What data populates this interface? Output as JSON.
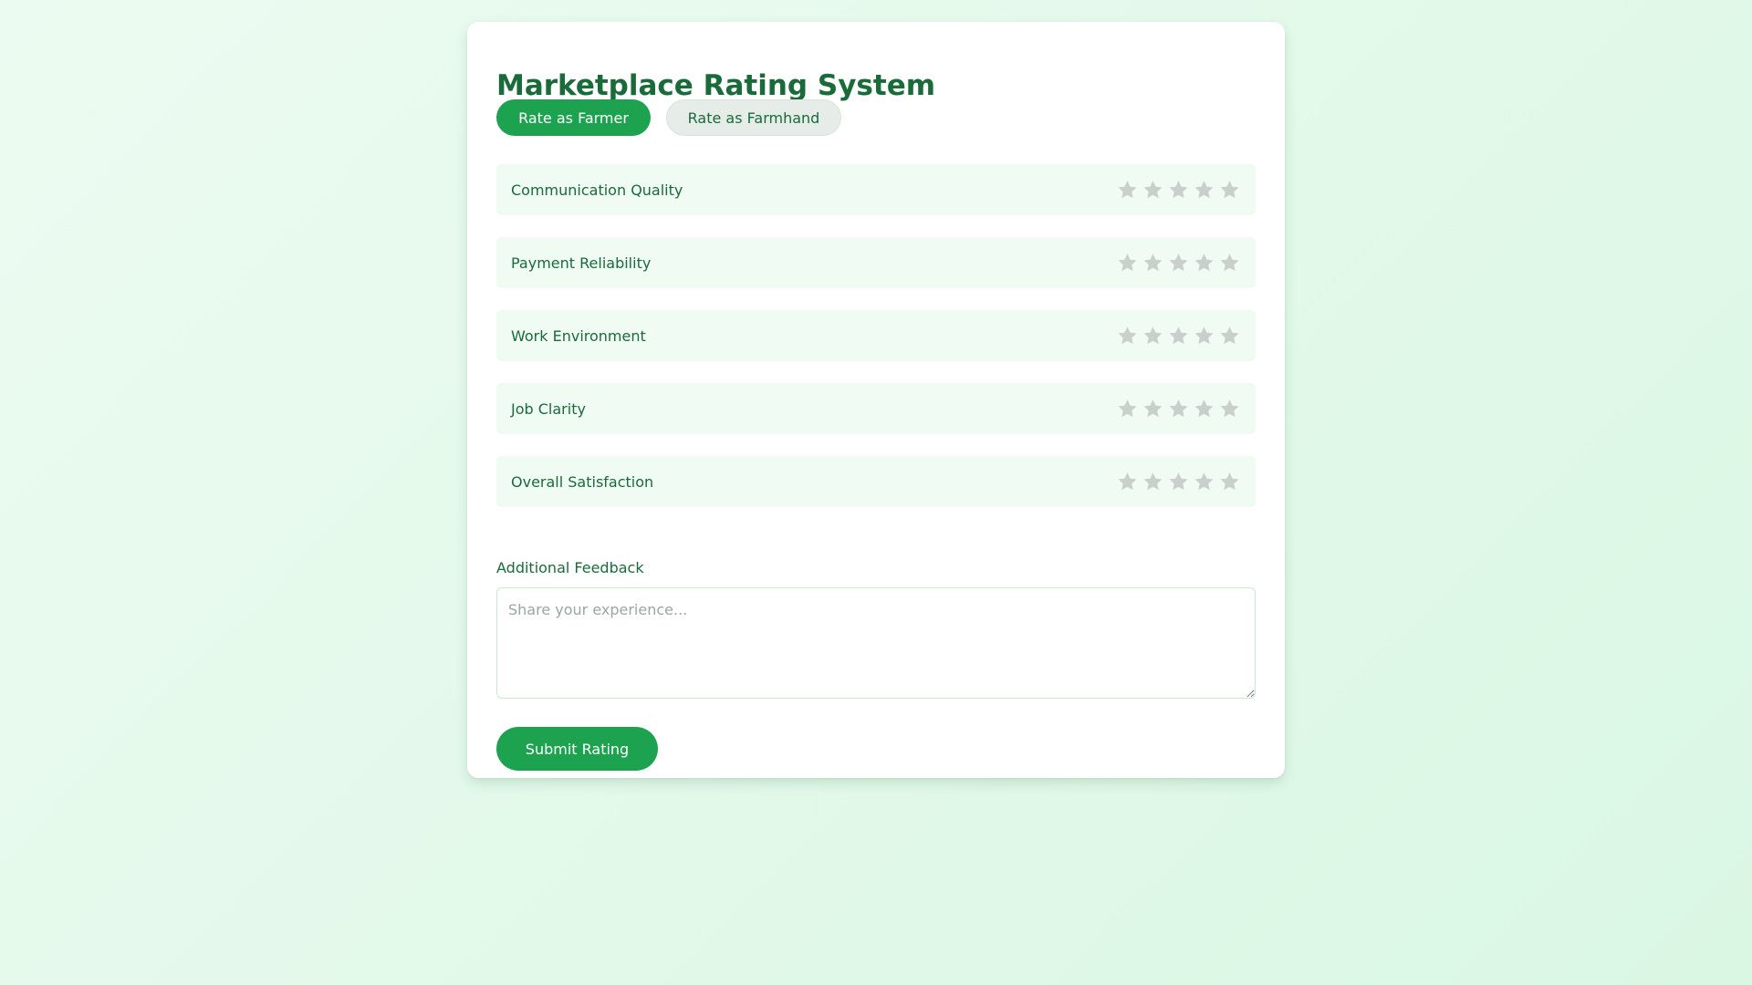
{
  "app": {
    "title": "Marketplace Rating System"
  },
  "roles": {
    "farmer_label": "Rate as Farmer",
    "farmhand_label": "Rate as Farmhand",
    "active": "farmer"
  },
  "criteria": [
    {
      "label": "Communication Quality",
      "rating": 0,
      "max": 5
    },
    {
      "label": "Payment Reliability",
      "rating": 0,
      "max": 5
    },
    {
      "label": "Work Environment",
      "rating": 0,
      "max": 5
    },
    {
      "label": "Job Clarity",
      "rating": 0,
      "max": 5
    },
    {
      "label": "Overall Satisfaction",
      "rating": 0,
      "max": 5
    }
  ],
  "feedback": {
    "label": "Additional Feedback",
    "placeholder": "Share your experience...",
    "value": ""
  },
  "submit": {
    "label": "Submit Rating"
  },
  "colors": {
    "accent": "#1da24f",
    "heading": "#196b3a",
    "star_empty": "#c9cfcc",
    "row_bg": "#f0fbf3"
  },
  "icons": {
    "star": "star-icon"
  }
}
